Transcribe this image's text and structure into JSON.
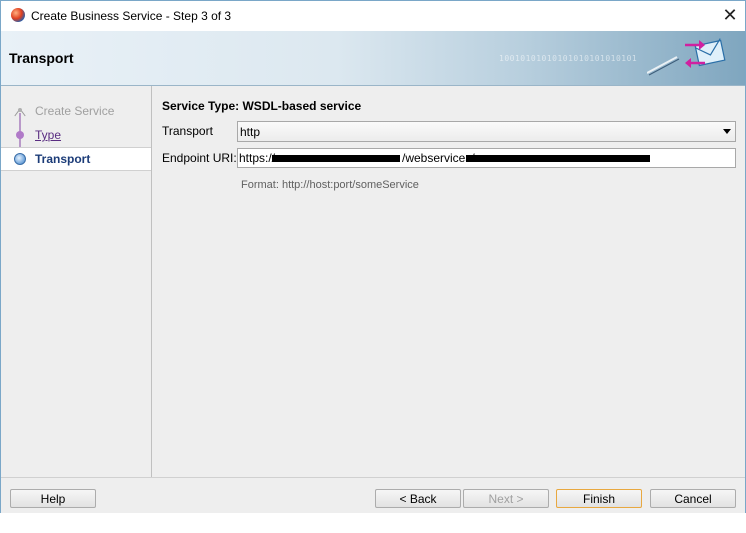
{
  "window": {
    "title": "Create Business Service - Step 3 of 3",
    "close_glyph": "✕"
  },
  "banner": {
    "title": "Transport",
    "binary_text": "10010101010101010101010101",
    "binary_text_2": "010101010"
  },
  "sidebar": {
    "steps": [
      {
        "label": "Create Service",
        "state": "done"
      },
      {
        "label": "Type",
        "state": "link"
      },
      {
        "label": "Transport",
        "state": "current"
      }
    ]
  },
  "form": {
    "service_type": "Service Type: WSDL-based service",
    "transport_label": "Transport",
    "transport_value": "http",
    "endpoint_label": "Endpoint URI:",
    "endpoint_prefix": "https://",
    "endpoint_mid": "/webservices/",
    "format_text": "Format:   http://host:port/someService"
  },
  "buttons": {
    "help": "Help",
    "back": "< Back",
    "next": "Next >",
    "finish": "Finish",
    "cancel": "Cancel"
  },
  "colors": {
    "link": "#5a2d82",
    "current_step": "#1c3c78",
    "default_button_border": "#e8a840"
  }
}
